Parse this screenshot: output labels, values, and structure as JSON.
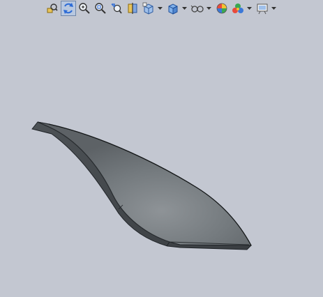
{
  "app": {
    "view": "graphics-area"
  },
  "heads_up_toolbar": {
    "buttons": [
      {
        "icon": "zoom-to-fit-icon",
        "active": false
      },
      {
        "icon": "rotate-view-icon",
        "active": true
      },
      {
        "icon": "zoom-in-out-icon",
        "active": false
      },
      {
        "icon": "zoom-to-area-icon",
        "active": false
      },
      {
        "icon": "previous-view-icon",
        "active": false
      },
      {
        "icon": "section-view-icon",
        "active": false
      },
      {
        "icon": "view-orientation-icon",
        "active": false,
        "dropdown": true
      },
      {
        "icon": "display-style-icon",
        "active": false,
        "dropdown": true
      },
      {
        "icon": "hide-show-items-icon",
        "active": false,
        "dropdown": true
      },
      {
        "icon": "edit-appearance-icon",
        "active": false
      },
      {
        "icon": "apply-scene-icon",
        "active": false,
        "dropdown": true
      },
      {
        "icon": "view-settings-icon",
        "active": false,
        "dropdown": true
      }
    ]
  },
  "colors": {
    "background": "#c3c7d1",
    "model_face": "#70757a",
    "model_edge": "#22262a",
    "active_button": "#b8c8e0"
  }
}
